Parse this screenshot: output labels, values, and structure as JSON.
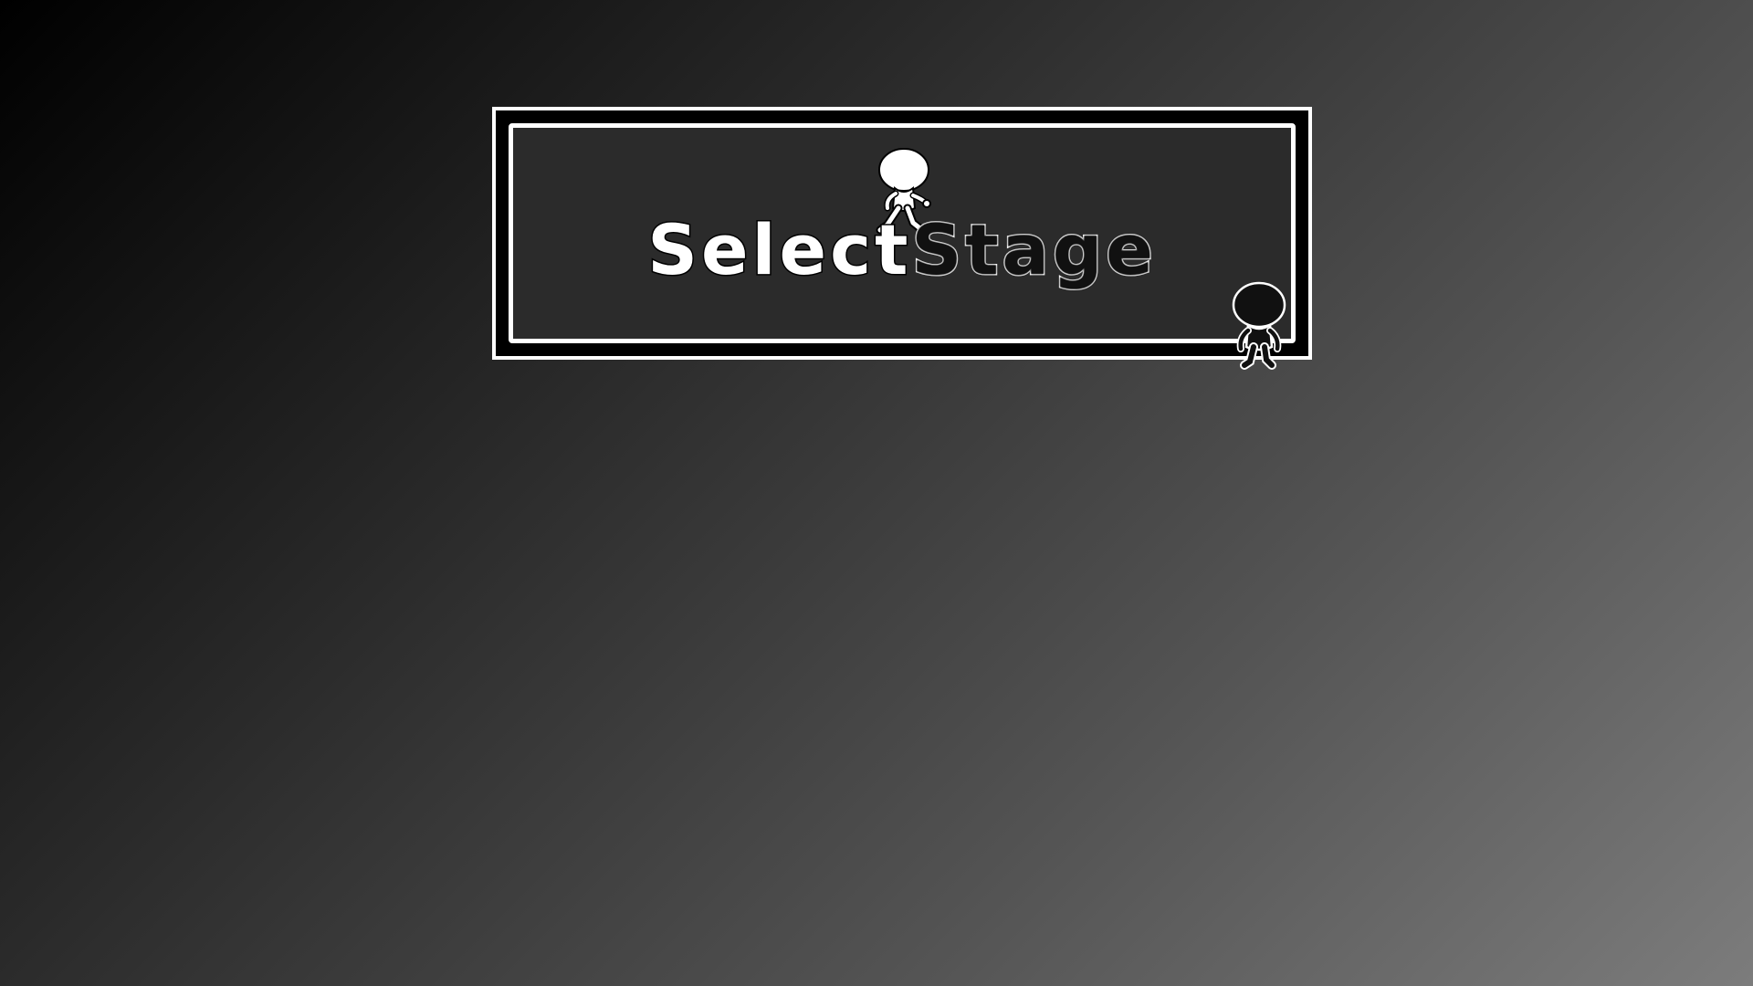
{
  "title": {
    "word_left": "Select",
    "word_right": "Stage"
  },
  "characters": {
    "left": {
      "icon": "white-walking-character-icon",
      "color": "#ffffff"
    },
    "right": {
      "icon": "black-standing-character-icon",
      "color": "#111111"
    }
  },
  "colors": {
    "frame_border": "#ffffff",
    "frame_fill": "#2b2b2b"
  }
}
